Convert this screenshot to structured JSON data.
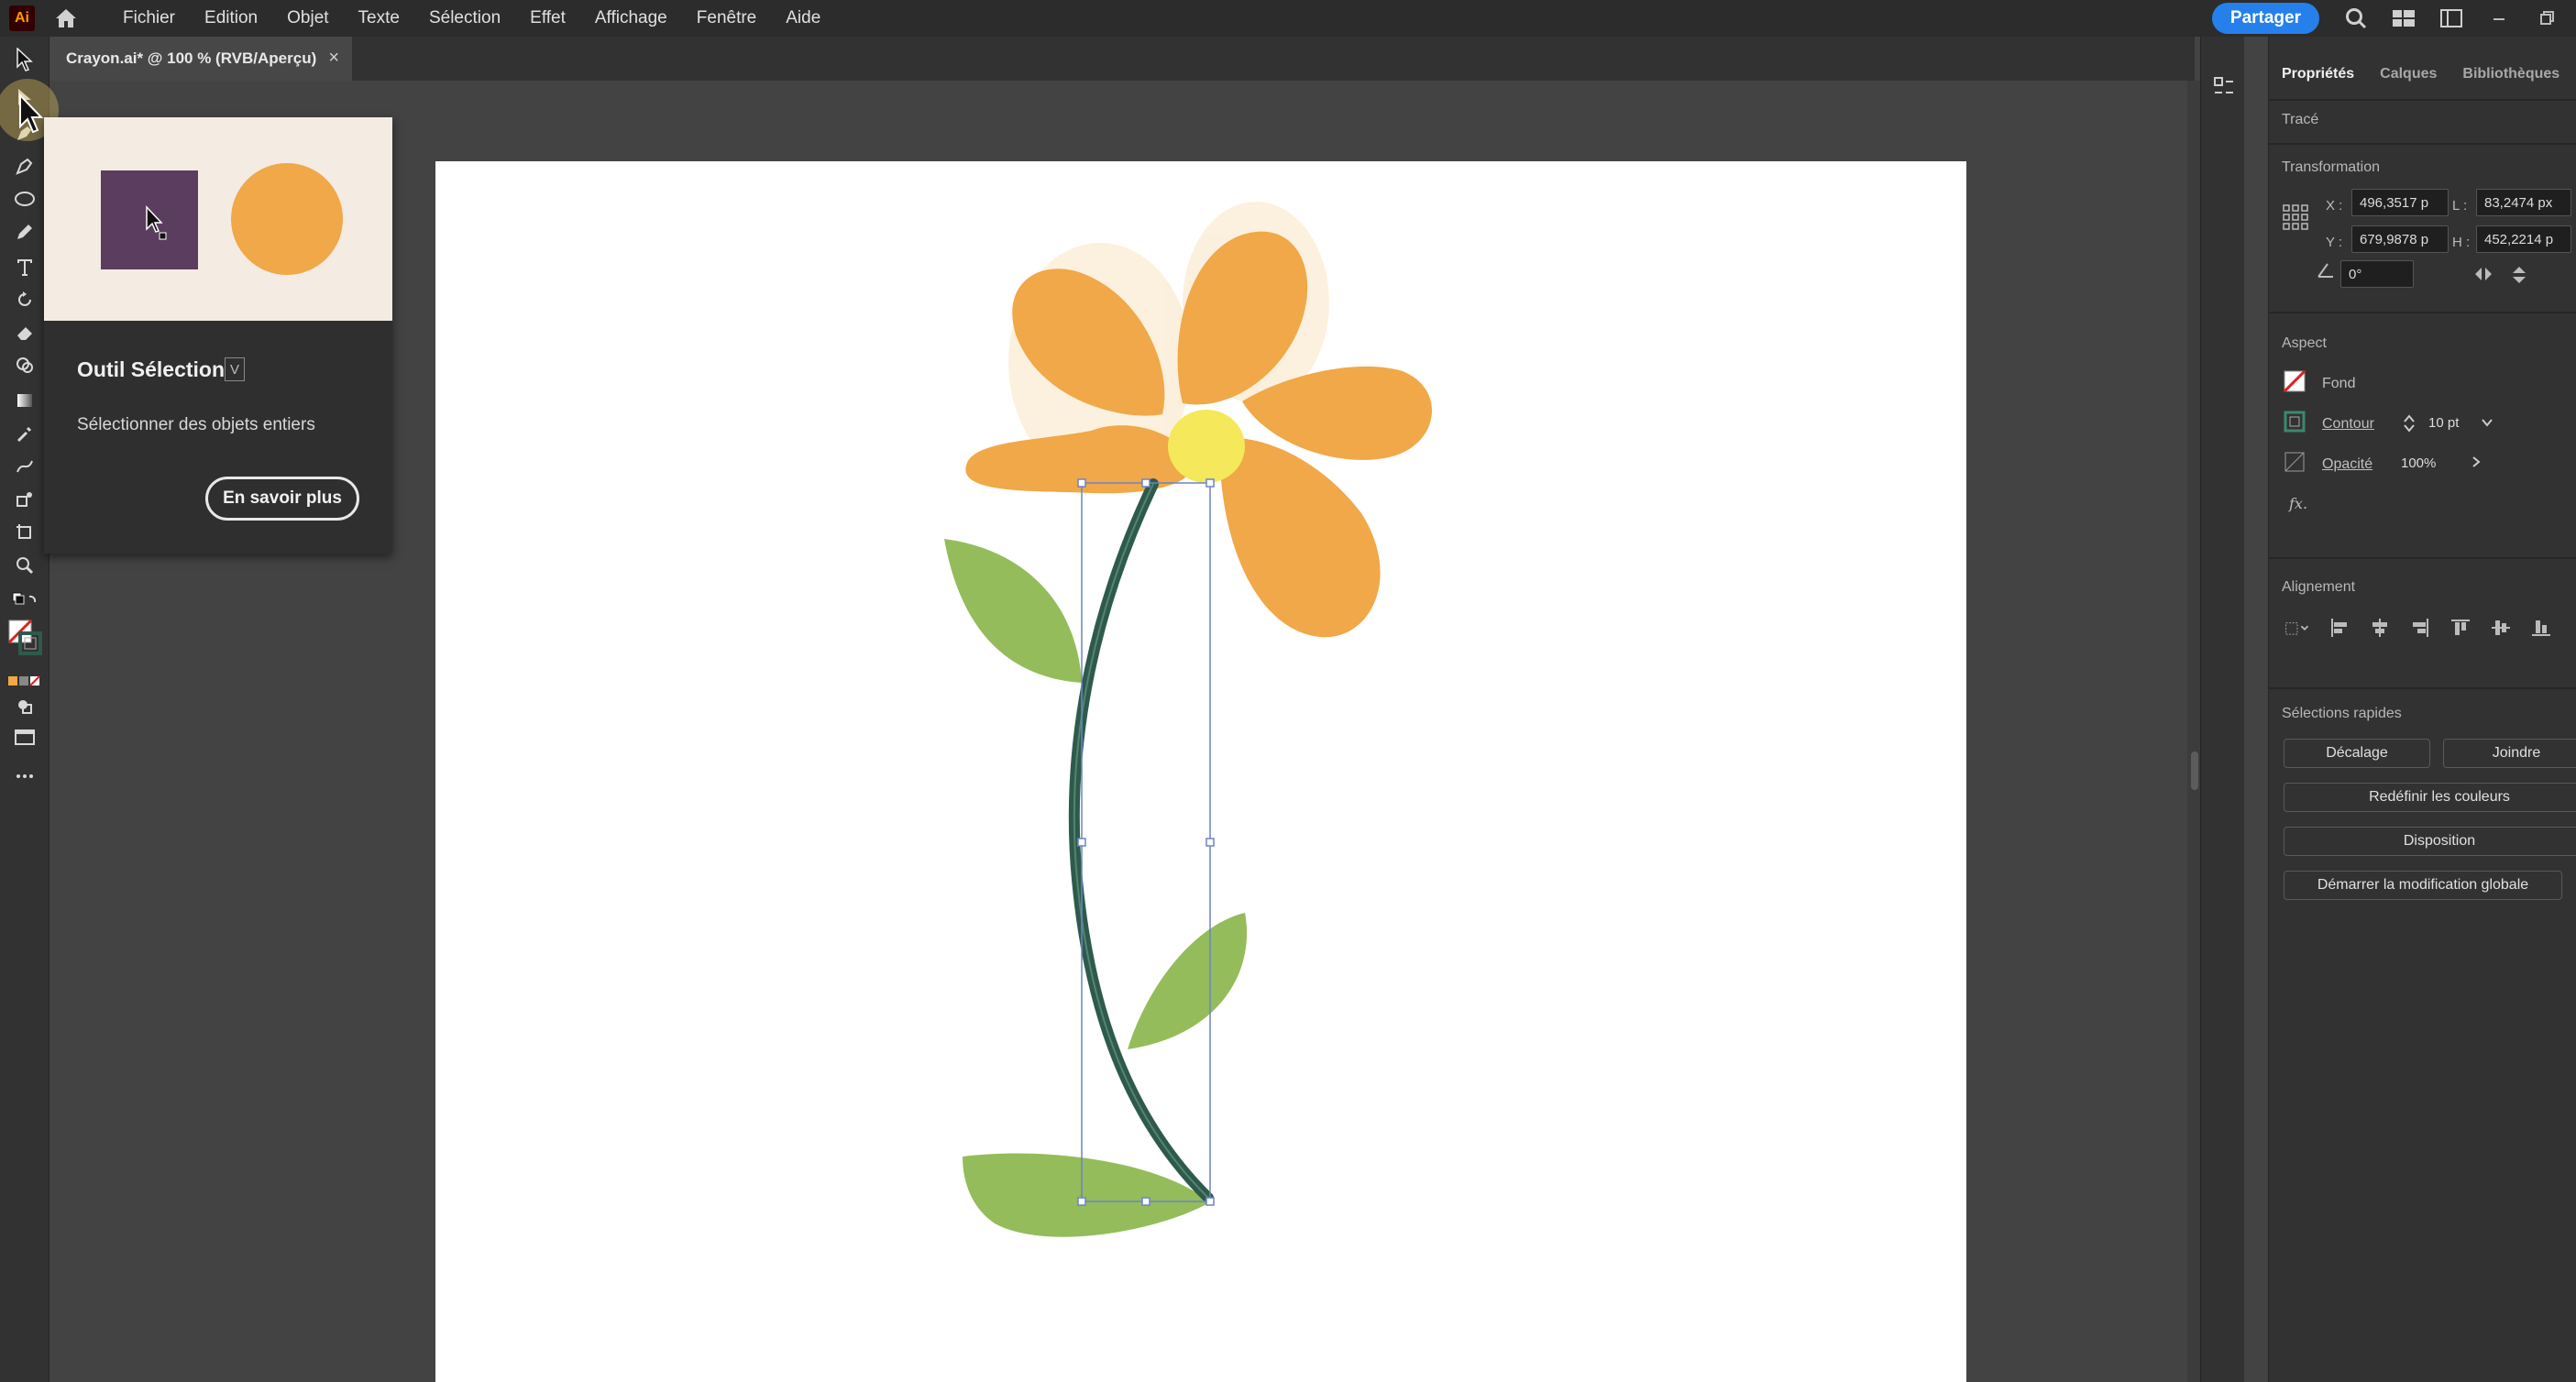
{
  "app": {
    "logo": "Ai"
  },
  "menu": [
    "Fichier",
    "Edition",
    "Objet",
    "Texte",
    "Sélection",
    "Effet",
    "Affichage",
    "Fenêtre",
    "Aide"
  ],
  "header": {
    "share_label": "Partager"
  },
  "document": {
    "tab_label": "Crayon.ai* @ 100 % (RVB/Aperçu)",
    "close_glyph": "×"
  },
  "tooltip": {
    "title": "Outil Sélection",
    "shortcut": "V",
    "description": "Sélectionner des objets entiers",
    "learn_more": "En savoir plus",
    "preview_colors": {
      "square": "#5b3d5f",
      "circle": "#f0a848",
      "background": "#f4ebe3"
    }
  },
  "properties": {
    "tabs": [
      "Propriétés",
      "Calques",
      "Bibliothèques"
    ],
    "object_type": "Tracé",
    "transformation": {
      "title": "Transformation",
      "x_label": "X :",
      "x_value": "496,3517 p",
      "y_label": "Y :",
      "y_value": "679,9878 p",
      "w_label": "L :",
      "w_value": "83,2474 px",
      "h_label": "H :",
      "h_value": "452,2214 p",
      "rotation_value": "0°"
    },
    "aspect": {
      "title": "Aspect",
      "fill_label": "Fond",
      "stroke_label": "Contour",
      "stroke_value": "10 pt",
      "opacity_label": "Opacité",
      "opacity_value": "100%",
      "fx_label": "fx."
    },
    "alignment": {
      "title": "Alignement"
    },
    "quick_actions": {
      "title": "Sélections rapides",
      "offset": "Décalage",
      "join": "Joindre",
      "recolor": "Redéfinir les couleurs",
      "arrange": "Disposition",
      "global_edit": "Démarrer la modification globale"
    }
  },
  "colors": {
    "petal": "#f0a848",
    "center": "#f5e85a",
    "stem": "#2e5a4c",
    "leaf": "#94bc5a",
    "accent": "#2680eb"
  }
}
